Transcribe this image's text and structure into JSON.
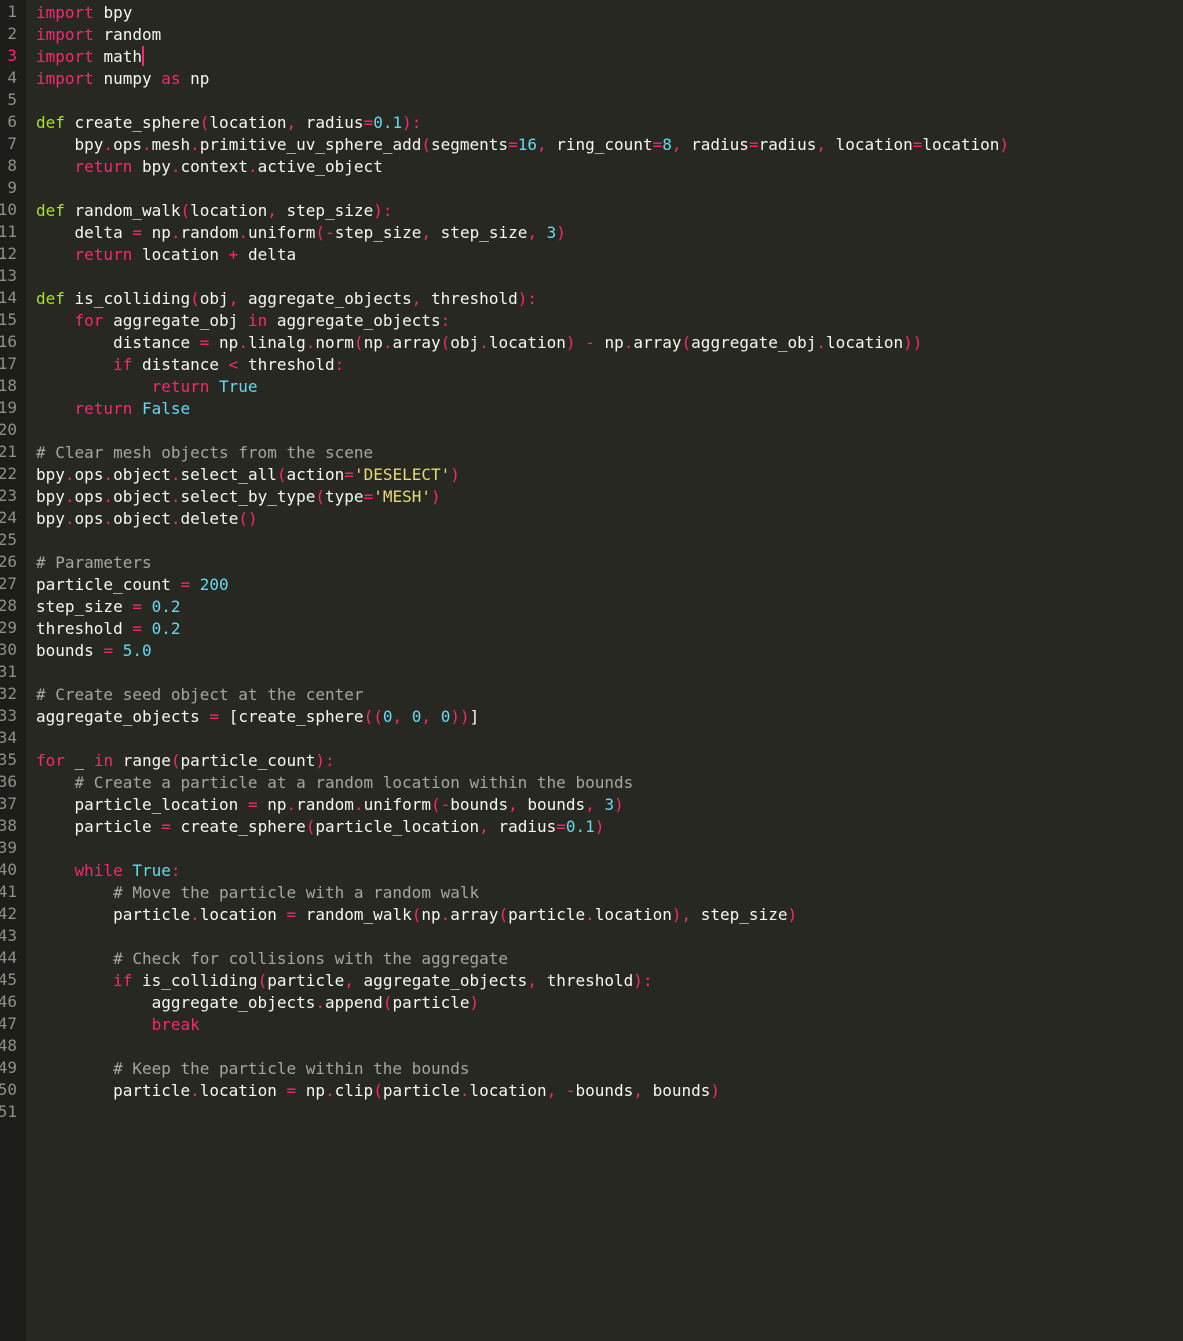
{
  "editor": {
    "language": "python",
    "cursor_line": 3,
    "colors": {
      "background": "#272822",
      "gutter": "#1d1e19",
      "keyword": "#f92672",
      "number": "#66d9ef",
      "string": "#e6db74",
      "comment": "#a6a69e",
      "text": "#f8f8f2"
    },
    "lines": [
      "import bpy",
      "import random",
      "import math",
      "import numpy as np",
      "",
      "def create_sphere(location, radius=0.1):",
      "    bpy.ops.mesh.primitive_uv_sphere_add(segments=16, ring_count=8, radius=radius, location=location)",
      "    return bpy.context.active_object",
      "",
      "def random_walk(location, step_size):",
      "    delta = np.random.uniform(-step_size, step_size, 3)",
      "    return location + delta",
      "",
      "def is_colliding(obj, aggregate_objects, threshold):",
      "    for aggregate_obj in aggregate_objects:",
      "        distance = np.linalg.norm(np.array(obj.location) - np.array(aggregate_obj.location))",
      "        if distance < threshold:",
      "            return True",
      "    return False",
      "",
      "# Clear mesh objects from the scene",
      "bpy.ops.object.select_all(action='DESELECT')",
      "bpy.ops.object.select_by_type(type='MESH')",
      "bpy.ops.object.delete()",
      "",
      "# Parameters",
      "particle_count = 200",
      "step_size = 0.2",
      "threshold = 0.2",
      "bounds = 5.0",
      "",
      "# Create seed object at the center",
      "aggregate_objects = [create_sphere((0, 0, 0))]",
      "",
      "for _ in range(particle_count):",
      "    # Create a particle at a random location within the bounds",
      "    particle_location = np.random.uniform(-bounds, bounds, 3)",
      "    particle = create_sphere(particle_location, radius=0.1)",
      "",
      "    while True:",
      "        # Move the particle with a random walk",
      "        particle.location = random_walk(np.array(particle.location), step_size)",
      "",
      "        # Check for collisions with the aggregate",
      "        if is_colliding(particle, aggregate_objects, threshold):",
      "            aggregate_objects.append(particle)",
      "            break",
      "",
      "        # Keep the particle within the bounds",
      "        particle.location = np.clip(particle.location, -bounds, bounds)",
      ""
    ]
  }
}
